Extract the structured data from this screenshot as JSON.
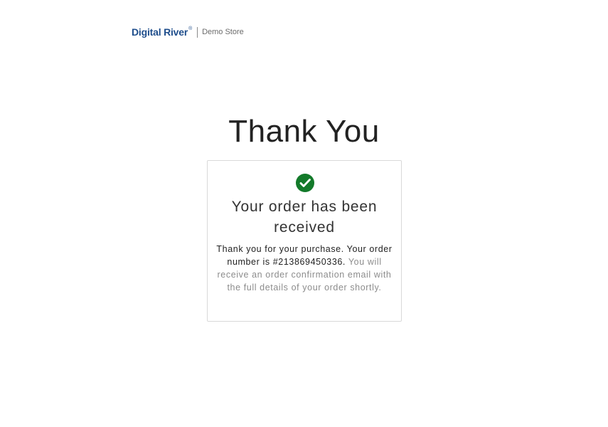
{
  "header": {
    "brand": "Digital River",
    "brand_mark": "®",
    "store_label": "Demo Store"
  },
  "main": {
    "title": "Thank You",
    "card": {
      "icon": "check-circle-icon",
      "heading": "Your order has been received",
      "message_primary": "Thank you for your purchase. Your order number is #213869450336.",
      "message_secondary": "You will receive an order confirmation email with the full details of your order shortly."
    }
  },
  "colors": {
    "brand_blue": "#1f4e8c",
    "success_green": "#137a2a",
    "title_text": "#222222",
    "muted_text": "#8c8c8c",
    "card_border": "#d9d9d9"
  }
}
